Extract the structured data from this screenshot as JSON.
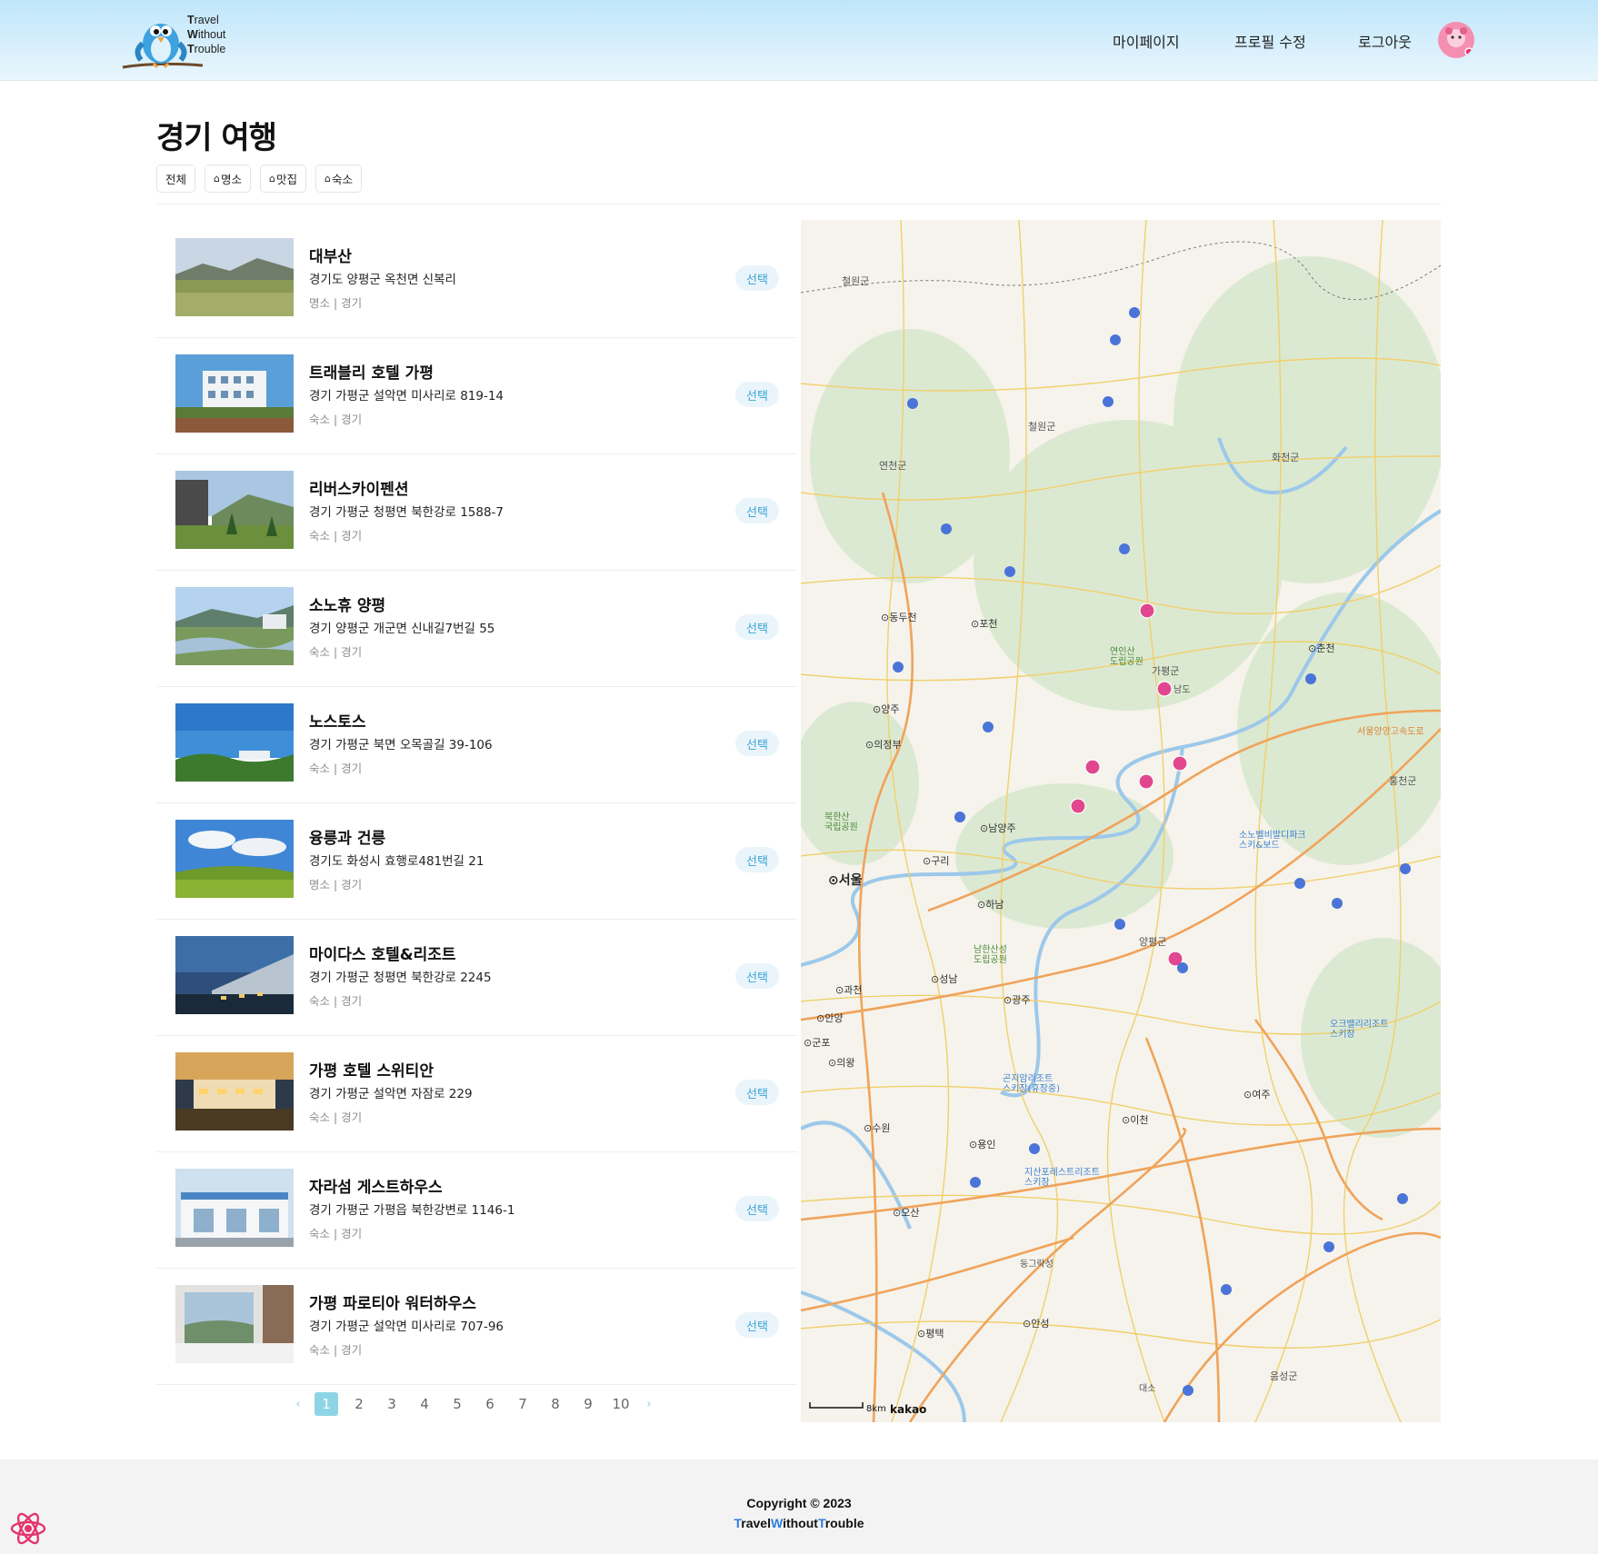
{
  "header": {
    "logo_lines": [
      {
        "initial": "T",
        "rest": "ravel"
      },
      {
        "initial": "W",
        "rest": "ithout"
      },
      {
        "initial": "T",
        "rest": "rouble"
      }
    ],
    "nav": {
      "mypage": "마이페이지",
      "edit_profile": "프로필 수정",
      "logout": "로그아웃"
    }
  },
  "page": {
    "title": "경기 여행",
    "filters": {
      "all": "전체",
      "sights": "명소",
      "food": "맛집",
      "stay": "숙소"
    }
  },
  "places": [
    {
      "name": "대부산",
      "address": "경기도 양평군 옥천면 신복리",
      "meta": "명소 | 경기",
      "button": "선택"
    },
    {
      "name": "트래블리 호텔 가평",
      "address": "경기 가평군 설악면 미사리로 819-14",
      "meta": "숙소 | 경기",
      "button": "선택"
    },
    {
      "name": "리버스카이펜션",
      "address": "경기 가평군 청평면 북한강로 1588-7",
      "meta": "숙소 | 경기",
      "button": "선택"
    },
    {
      "name": "소노휴 양평",
      "address": "경기 양평군 개군면 신내길7번길 55",
      "meta": "숙소 | 경기",
      "button": "선택"
    },
    {
      "name": "노스토스",
      "address": "경기 가평군 북면 오목골길 39-106",
      "meta": "숙소 | 경기",
      "button": "선택"
    },
    {
      "name": "융릉과 건릉",
      "address": "경기도 화성시 효행로481번길 21",
      "meta": "명소 | 경기",
      "button": "선택"
    },
    {
      "name": "마이다스 호텔&리조트",
      "address": "경기 가평군 청평면 북한강로 2245",
      "meta": "숙소 | 경기",
      "button": "선택"
    },
    {
      "name": "가평 호텔 스위티안",
      "address": "경기 가평군 설악면 자잠로 229",
      "meta": "숙소 | 경기",
      "button": "선택"
    },
    {
      "name": "자라섬 게스트하우스",
      "address": "경기 가평군 가평읍 북한강변로 1146-1",
      "meta": "숙소 | 경기",
      "button": "선택"
    },
    {
      "name": "가평 파로티아 워터하우스",
      "address": "경기 가평군 설악면 미사리로 707-96",
      "meta": "숙소 | 경기",
      "button": "선택"
    }
  ],
  "pagination": {
    "prev": "‹",
    "next": "›",
    "pages": [
      "1",
      "2",
      "3",
      "4",
      "5",
      "6",
      "7",
      "8",
      "9",
      "10"
    ],
    "current": "1"
  },
  "map": {
    "labels": {
      "cheorwon_top": "철원군",
      "cheorwon": "철원군",
      "yeoncheon": "연천군",
      "hwacheon": "화천군",
      "dongducheon": "⊙동두천",
      "pocheon": "⊙포천",
      "yeoninsan": "연인산\n도립공원",
      "gapyeong": "가평군",
      "namdo": "남도",
      "chuncheon": "⊙춘천",
      "yangju": "⊙양주",
      "uijeongbu": "⊙의정부",
      "bukhansan": "북한산\n국립공원",
      "namyangju": "⊙남양주",
      "guri": "⊙구리",
      "seoul": "⊙서울",
      "hanam": "⊙하남",
      "sono": "소노벨비발디파크\n스키&보드",
      "hongcheon": "홍천군",
      "seoul_yangyang": "서울양양고속도로",
      "namhansanseong": "남한산성\n도립공원",
      "yangpyeong": "양평군",
      "gwacheon": "⊙과천",
      "seongnam": "⊙성남",
      "gwangju": "⊙광주",
      "anyang": "⊙안양",
      "gunpo": "⊙군포",
      "uiwang": "⊙의왕",
      "gonjiam": "곤지암리조트\n스키장(휴장중)",
      "oak": "오크밸리리조트\n스키장",
      "yeoju": "⊙여주",
      "icheon": "⊙이천",
      "suwon": "⊙수원",
      "yongin": "⊙용인",
      "jisan": "지산포레스트리조트\n스키장",
      "osan": "⊙오산",
      "pyeongtaek": "⊙평택",
      "anseong": "⊙안성",
      "eumseong": "음성군",
      "dongtan": "동그락성",
      "daeso": "대소",
      "scale": "8km",
      "provider": "kakao"
    }
  },
  "footer": {
    "copyright": "Copyright © 2023",
    "brand": [
      {
        "text": "T",
        "accent": true
      },
      {
        "text": "ravel",
        "accent": false
      },
      {
        "text": "W",
        "accent": true
      },
      {
        "text": "ithout",
        "accent": false
      },
      {
        "text": "T",
        "accent": true
      },
      {
        "text": "rouble",
        "accent": false
      }
    ]
  },
  "colors": {
    "accent": "#2c7ee0",
    "select_button_bg": "#eaf5fb",
    "select_button_text": "#3aa3d6",
    "pagination_active": "#8dd5e6",
    "map_marker": "#e0478f"
  }
}
